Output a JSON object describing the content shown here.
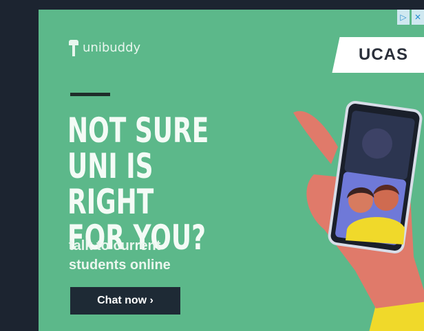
{
  "ad": {
    "brand": "unibuddy",
    "partner_logo": "UCAS",
    "headline_lines": [
      "NOT SURE",
      "UNI IS RIGHT",
      "FOR YOU?"
    ],
    "subline_lines": [
      "talk to current",
      "students online"
    ],
    "cta_label": "Chat now ›",
    "icons": {
      "adchoices_info": "info-icon",
      "adchoices_close": "close-icon",
      "brand_mark": "unibuddy-logo-icon"
    },
    "colors": {
      "background": "#5cb88a",
      "page": "#1c2430",
      "cta": "#1e2a35",
      "accent_yellow": "#f0d92a"
    }
  }
}
